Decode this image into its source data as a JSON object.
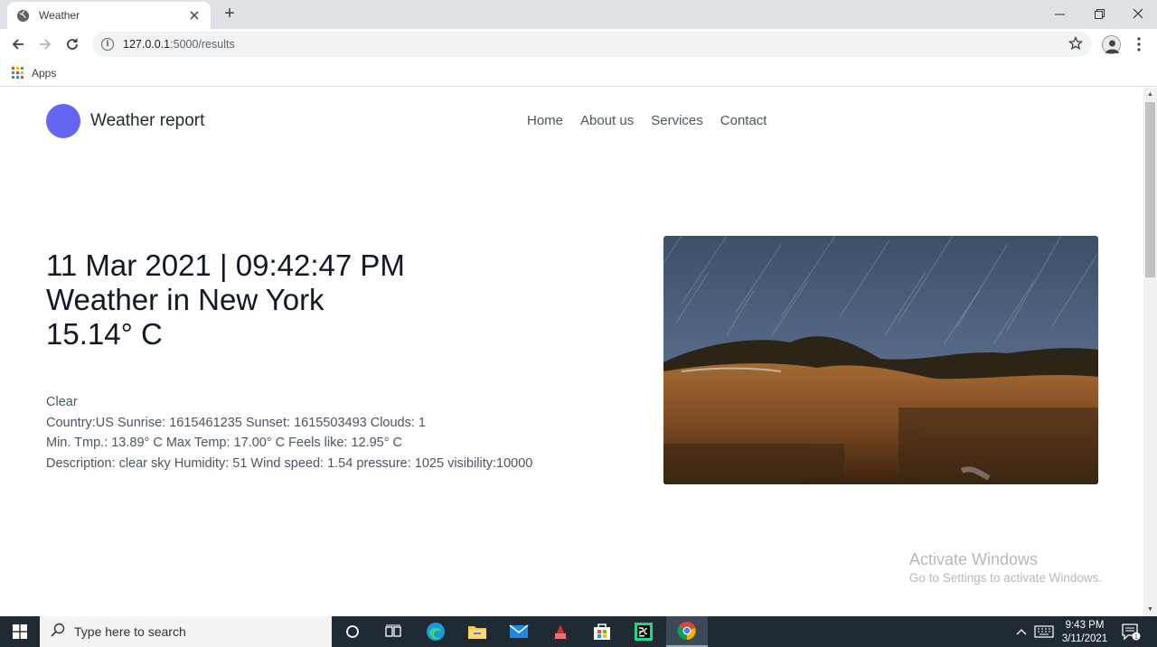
{
  "browser": {
    "tab_title": "Weather",
    "url_host": "127.0.0.1",
    "url_rest": ":5000/results",
    "bookmark_apps": "Apps"
  },
  "site": {
    "brand": "Weather report",
    "nav": [
      "Home",
      "About us",
      "Services",
      "Contact"
    ],
    "accent_color": "#6366f1"
  },
  "weather": {
    "datetime": "11 Mar 2021 | 09:42:47 PM",
    "location_line": "Weather in New York",
    "temperature": "15.14° C",
    "condition": "Clear",
    "line_country": "Country:US Sunrise: 1615461235 Sunset: 1615503493 Clouds: 1",
    "line_temps": "Min. Tmp.: 13.89° C Max Temp: 17.00° C Feels like: 12.95° C",
    "line_desc": "Description: clear sky Humidity: 51 Wind speed: 1.54 pressure: 1025 visibility:10000"
  },
  "watermark": {
    "line1": "Activate Windows",
    "line2": "Go to Settings to activate Windows."
  },
  "taskbar": {
    "search_placeholder": "Type here to search",
    "time": "9:43 PM",
    "date": "3/11/2021",
    "notification_count": "1"
  }
}
